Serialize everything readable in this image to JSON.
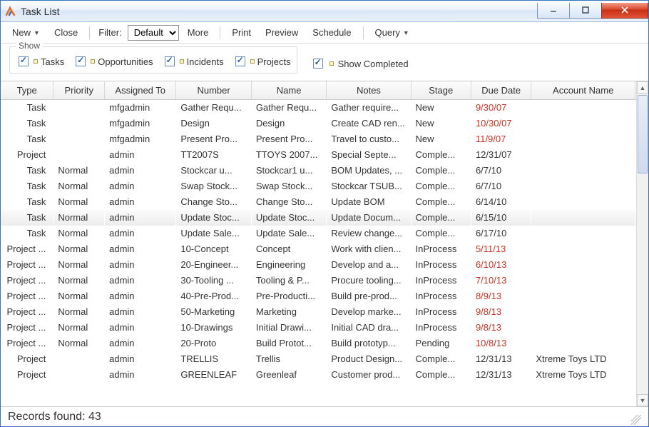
{
  "window": {
    "title": "Task List"
  },
  "toolbar": {
    "new_label": "New",
    "close_label": "Close",
    "filter_label": "Filter:",
    "filter_value": "Default",
    "more_label": "More",
    "print_label": "Print",
    "preview_label": "Preview",
    "schedule_label": "Schedule",
    "query_label": "Query"
  },
  "filters": {
    "group_label": "Show",
    "tasks": "Tasks",
    "opportunities": "Opportunities",
    "incidents": "Incidents",
    "projects": "Projects",
    "show_completed": "Show Completed"
  },
  "columns": {
    "type": "Type",
    "priority": "Priority",
    "assigned": "Assigned To",
    "number": "Number",
    "name": "Name",
    "notes": "Notes",
    "stage": "Stage",
    "due": "Due Date",
    "account": "Account Name"
  },
  "rows": [
    {
      "type": "Task",
      "priority": "",
      "assigned": "mfgadmin",
      "number": "Gather Requ...",
      "name": "Gather Requ...",
      "notes": "Gather require...",
      "stage": "New",
      "due": "9/30/07",
      "overdue": true,
      "account": ""
    },
    {
      "type": "Task",
      "priority": "",
      "assigned": "mfgadmin",
      "number": "Design",
      "name": "Design",
      "notes": "Create CAD ren...",
      "stage": "New",
      "due": "10/30/07",
      "overdue": true,
      "account": ""
    },
    {
      "type": "Task",
      "priority": "",
      "assigned": "mfgadmin",
      "number": "Present Pro...",
      "name": "Present Pro...",
      "notes": "Travel to custo...",
      "stage": "New",
      "due": "11/9/07",
      "overdue": true,
      "account": ""
    },
    {
      "type": "Project",
      "priority": "",
      "assigned": "admin",
      "number": "TT2007S",
      "name": "TTOYS 2007...",
      "notes": "Special Septe...",
      "stage": "Comple...",
      "due": "12/31/07",
      "overdue": false,
      "account": ""
    },
    {
      "type": "Task",
      "priority": "Normal",
      "assigned": "admin",
      "number": "Stockcar u...",
      "name": "Stockcar1 u...",
      "notes": "BOM Updates, ...",
      "stage": "Comple...",
      "due": "6/7/10",
      "overdue": false,
      "account": ""
    },
    {
      "type": "Task",
      "priority": "Normal",
      "assigned": "admin",
      "number": "Swap Stock...",
      "name": "Swap Stock...",
      "notes": "Stockcar TSUB...",
      "stage": "Comple...",
      "due": "6/7/10",
      "overdue": false,
      "account": ""
    },
    {
      "type": "Task",
      "priority": "Normal",
      "assigned": "admin",
      "number": "Change Sto...",
      "name": "Change Sto...",
      "notes": "Update BOM",
      "stage": "Comple...",
      "due": "6/14/10",
      "overdue": false,
      "account": ""
    },
    {
      "type": "Task",
      "priority": "Normal",
      "assigned": "admin",
      "number": "Update Stoc...",
      "name": "Update Stoc...",
      "notes": "Update Docum...",
      "stage": "Comple...",
      "due": "6/15/10",
      "overdue": false,
      "account": "",
      "hover": true
    },
    {
      "type": "Task",
      "priority": "Normal",
      "assigned": "admin",
      "number": "Update Sale...",
      "name": "Update Sale...",
      "notes": "Review change...",
      "stage": "Comple...",
      "due": "6/17/10",
      "overdue": false,
      "account": ""
    },
    {
      "type": "Project ...",
      "priority": "Normal",
      "assigned": "admin",
      "number": "10-Concept",
      "name": "Concept",
      "notes": "Work with clien...",
      "stage": "InProcess",
      "due": "5/11/13",
      "overdue": true,
      "account": ""
    },
    {
      "type": "Project ...",
      "priority": "Normal",
      "assigned": "admin",
      "number": "20-Engineer...",
      "name": "Engineering",
      "notes": "Develop and a...",
      "stage": "InProcess",
      "due": "6/10/13",
      "overdue": true,
      "account": ""
    },
    {
      "type": "Project ...",
      "priority": "Normal",
      "assigned": "admin",
      "number": "30-Tooling ...",
      "name": "Tooling & P...",
      "notes": "Procure tooling...",
      "stage": "InProcess",
      "due": "7/10/13",
      "overdue": true,
      "account": ""
    },
    {
      "type": "Project ...",
      "priority": "Normal",
      "assigned": "admin",
      "number": "40-Pre-Prod...",
      "name": "Pre-Producti...",
      "notes": "Build pre-prod...",
      "stage": "InProcess",
      "due": "8/9/13",
      "overdue": true,
      "account": ""
    },
    {
      "type": "Project ...",
      "priority": "Normal",
      "assigned": "admin",
      "number": "50-Marketing",
      "name": "Marketing",
      "notes": "Develop marke...",
      "stage": "InProcess",
      "due": "9/8/13",
      "overdue": true,
      "account": ""
    },
    {
      "type": "Project ...",
      "priority": "Normal",
      "assigned": "admin",
      "number": "10-Drawings",
      "name": "Initial Drawi...",
      "notes": "Initial CAD dra...",
      "stage": "InProcess",
      "due": "9/8/13",
      "overdue": true,
      "account": ""
    },
    {
      "type": "Project ...",
      "priority": "Normal",
      "assigned": "admin",
      "number": "20-Proto",
      "name": "Build Protot...",
      "notes": "Build prototyp...",
      "stage": "Pending",
      "due": "10/8/13",
      "overdue": true,
      "account": ""
    },
    {
      "type": "Project",
      "priority": "",
      "assigned": "admin",
      "number": "TRELLIS",
      "name": "Trellis",
      "notes": "Product Design...",
      "stage": "Comple...",
      "due": "12/31/13",
      "overdue": false,
      "account": "Xtreme Toys LTD"
    },
    {
      "type": "Project",
      "priority": "",
      "assigned": "admin",
      "number": "GREENLEAF",
      "name": "Greenleaf",
      "notes": "Customer prod...",
      "stage": "Comple...",
      "due": "12/31/13",
      "overdue": false,
      "account": "Xtreme Toys LTD"
    }
  ],
  "status": {
    "records_found": "Records found: 43"
  }
}
